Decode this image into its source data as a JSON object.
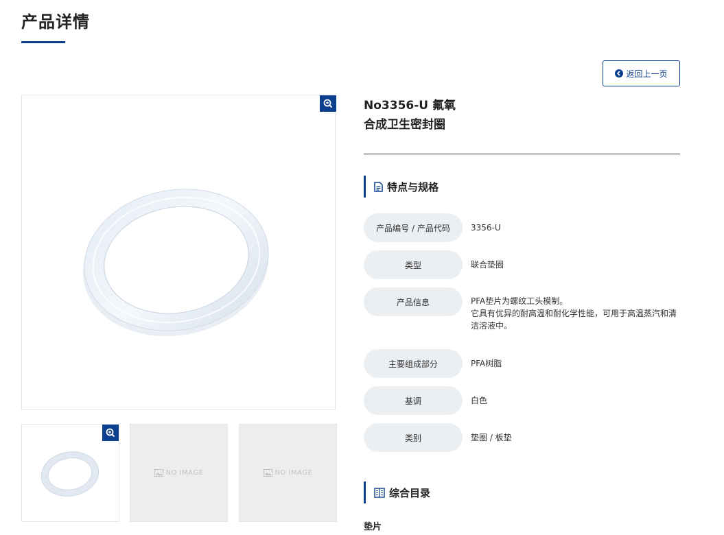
{
  "page_title": "产品详情",
  "back_button_label": "返回上一页",
  "gallery": {
    "no_image_label": "NO IMAGE"
  },
  "product": {
    "title_line1": "No3356-U 氟氧",
    "title_line2": "合成卫生密封圈"
  },
  "specs_section": {
    "heading": "特点与规格",
    "rows": [
      {
        "label": "产品编号 / 产品代码",
        "value": "3356-U"
      },
      {
        "label": "类型",
        "value": "联合垫圈"
      },
      {
        "label": "产品信息",
        "value": "PFA垫片为螺纹工头模制。\n它具有优异的耐高温和耐化学性能，可用于高温蒸汽和清洁溶液中。"
      },
      {
        "label": "主要组成部分",
        "value": "PFA树脂"
      },
      {
        "label": "基调",
        "value": "白色"
      },
      {
        "label": "类别",
        "value": "垫圈 / 板垫"
      }
    ]
  },
  "catalog_section": {
    "heading": "综合目录",
    "items": [
      "垫片"
    ]
  },
  "colors": {
    "accent": "#0d3f8f",
    "label_bg": "#eceff2"
  }
}
